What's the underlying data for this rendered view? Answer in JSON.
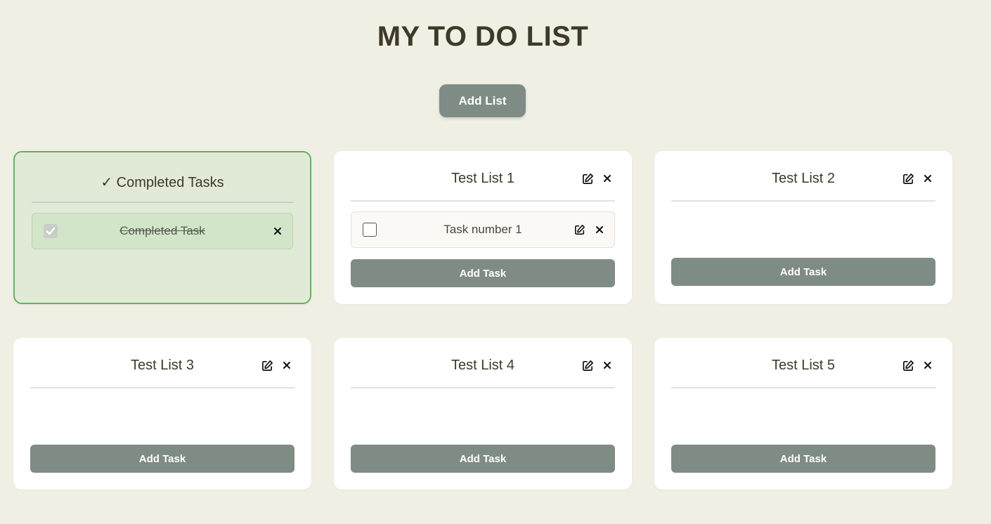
{
  "page": {
    "title": "MY TO DO LIST",
    "add_list_label": "Add List"
  },
  "completed": {
    "title": "✓ Completed Tasks",
    "tasks": [
      {
        "text": "Completed Task",
        "checked": true
      }
    ]
  },
  "lists": [
    {
      "title": "Test List 1",
      "add_task_label": "Add Task",
      "tasks": [
        {
          "text": "Task number 1",
          "checked": false
        }
      ]
    },
    {
      "title": "Test List 2",
      "add_task_label": "Add Task",
      "tasks": []
    },
    {
      "title": "Test List 3",
      "add_task_label": "Add Task",
      "tasks": []
    },
    {
      "title": "Test List 4",
      "add_task_label": "Add Task",
      "tasks": []
    },
    {
      "title": "Test List 5",
      "add_task_label": "Add Task",
      "tasks": []
    }
  ],
  "icons": {
    "edit": "edit-icon",
    "close": "close-icon",
    "check": "check-icon"
  },
  "colors": {
    "accent": "#7f8c85",
    "completed_border": "#5cb85c",
    "background": "#f0efe4"
  }
}
